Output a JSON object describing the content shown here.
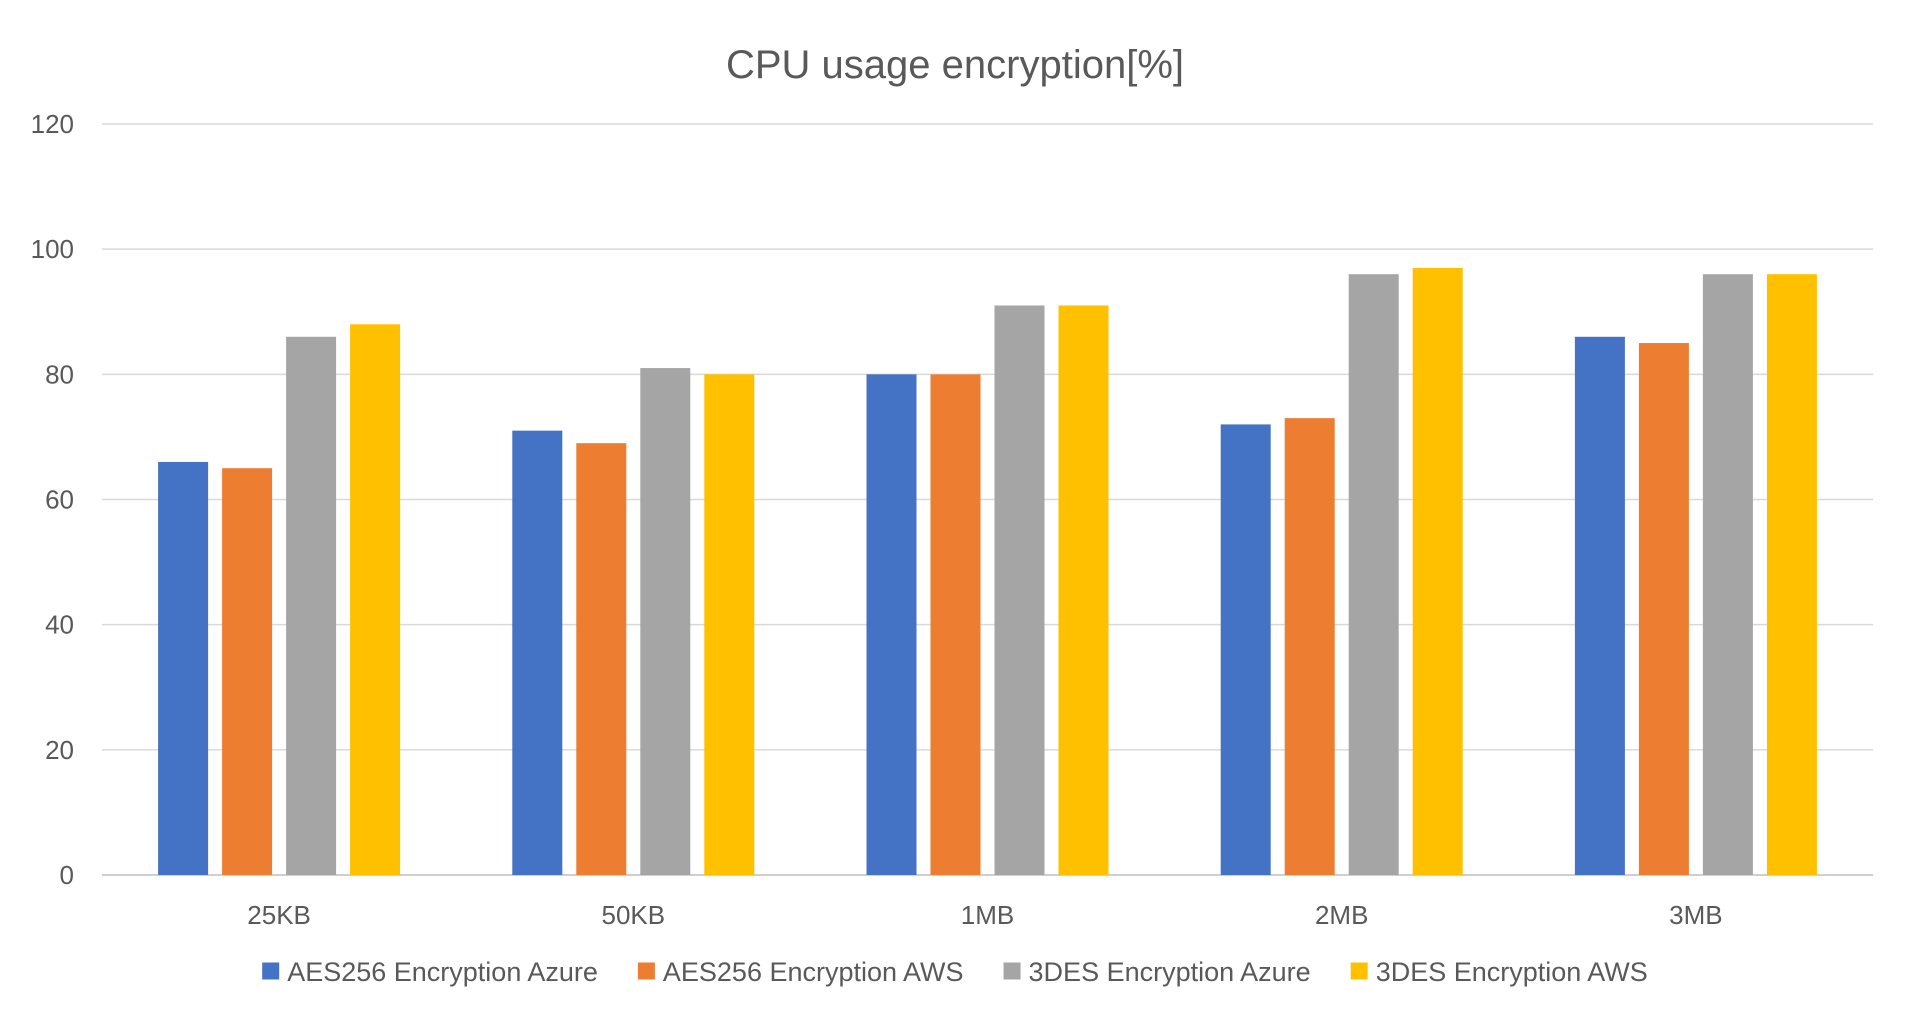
{
  "chart_data": {
    "type": "bar",
    "title": "CPU usage encryption[%]",
    "xlabel": "",
    "ylabel": "",
    "ylim": [
      0,
      120
    ],
    "yticks": [
      0,
      20,
      40,
      60,
      80,
      100,
      120
    ],
    "grid": true,
    "legend_position": "bottom",
    "categories": [
      "25KB",
      "50KB",
      "1MB",
      "2MB",
      "3MB"
    ],
    "series": [
      {
        "name": "AES256 Encryption Azure",
        "color": "#4472c4",
        "values": [
          66,
          71,
          80,
          72,
          86
        ]
      },
      {
        "name": "AES256 Encryption AWS",
        "color": "#ed7d31",
        "values": [
          65,
          69,
          80,
          73,
          85
        ]
      },
      {
        "name": "3DES Encryption Azure",
        "color": "#a5a5a5",
        "values": [
          86,
          81,
          91,
          96,
          96
        ]
      },
      {
        "name": "3DES Encryption AWS",
        "color": "#ffc000",
        "values": [
          88,
          80,
          91,
          97,
          96
        ]
      }
    ]
  }
}
